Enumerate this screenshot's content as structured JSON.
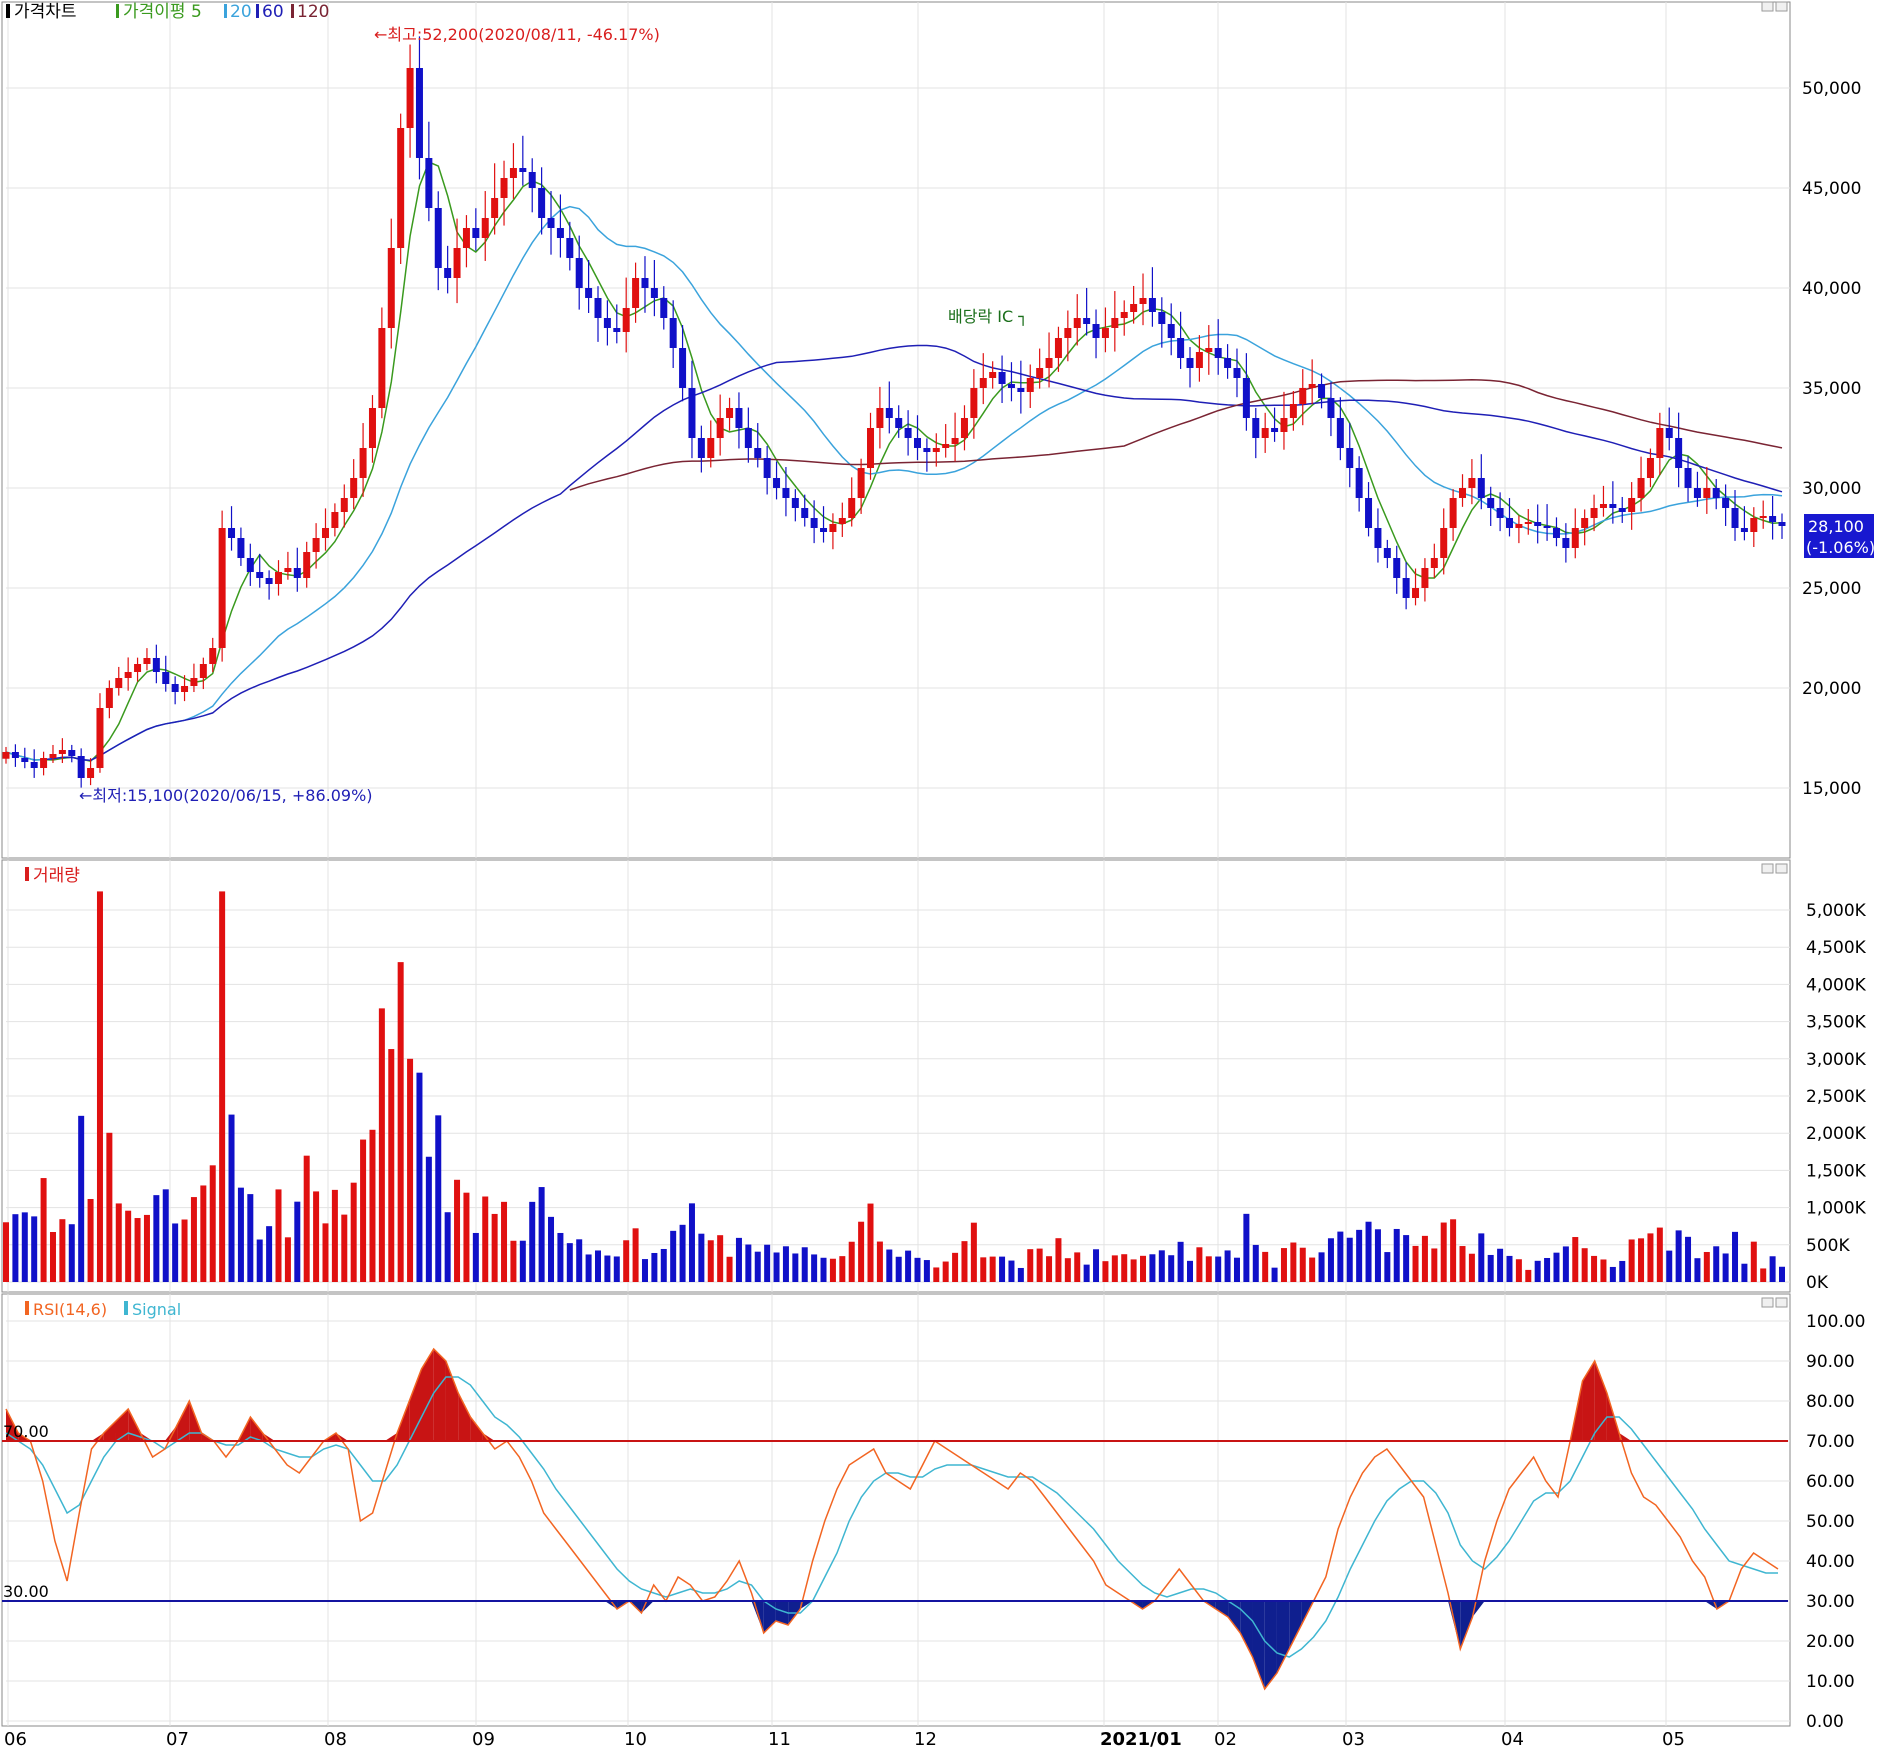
{
  "panels": {
    "price": {
      "legend": [
        {
          "label": "가격차트",
          "color": "#000000"
        },
        {
          "label": "가격이평 5",
          "color": "#3a9a1e"
        },
        {
          "label": "20",
          "color": "#3ba3dc"
        },
        {
          "label": "60",
          "color": "#1f1fb5"
        },
        {
          "label": "120",
          "color": "#7a2433"
        }
      ],
      "annotations": {
        "high": "←최고:52,200(2020/08/11, -46.17%)",
        "low": "←최저:15,100(2020/06/15, +86.09%)",
        "dividend": "배당락 ⅠC ┐"
      },
      "current_price": "28,100",
      "current_change": "(-1.06%)"
    },
    "volume": {
      "legend": "거래량"
    },
    "rsi": {
      "legend": [
        {
          "label": "RSI(14,6)",
          "color": "#f26522"
        },
        {
          "label": "Signal",
          "color": "#3fb6d1"
        }
      ],
      "level_high_label": "70.00",
      "level_low_label": "30.00"
    }
  },
  "chart_data": [
    {
      "type": "candlestick",
      "title": "가격차트",
      "x_labels": [
        "06",
        "07",
        "08",
        "09",
        "10",
        "11",
        "12",
        "2021/01",
        "02",
        "03",
        "04",
        "05"
      ],
      "ylim": [
        12000,
        54000
      ],
      "yticks": [
        "15,000",
        "20,000",
        "25,000",
        "30,000",
        "35,000",
        "40,000",
        "45,000",
        "50,000"
      ],
      "ytick_values": [
        15000,
        20000,
        25000,
        30000,
        35000,
        40000,
        45000,
        50000
      ],
      "series_close": [
        16800,
        16500,
        16300,
        16000,
        16500,
        16700,
        16900,
        16600,
        15500,
        16000,
        19000,
        20000,
        20500,
        20800,
        21200,
        21500,
        20800,
        20200,
        19800,
        20100,
        20500,
        21200,
        22000,
        28000,
        27500,
        26500,
        25800,
        25500,
        25200,
        25800,
        26000,
        25500,
        26800,
        27500,
        28000,
        28800,
        29500,
        30500,
        32000,
        34000,
        38000,
        42000,
        48000,
        51000,
        46500,
        44000,
        41000,
        40500,
        42000,
        43000,
        42500,
        43500,
        44500,
        45500,
        46000,
        45800,
        45000,
        43500,
        43000,
        42500,
        41500,
        40000,
        39500,
        38500,
        38000,
        37800,
        39000,
        40500,
        40000,
        39500,
        38500,
        37000,
        35000,
        32500,
        31500,
        32500,
        33500,
        34000,
        33000,
        32000,
        31500,
        30500,
        30000,
        29500,
        29000,
        28500,
        28000,
        27800,
        28200,
        28500,
        29500,
        31000,
        33000,
        34000,
        33500,
        33000,
        32500,
        32000,
        31800,
        32000,
        32200,
        32500,
        33500,
        35000,
        35500,
        35800,
        35200,
        35000,
        34800,
        35500,
        36000,
        36500,
        37500,
        38000,
        38500,
        38200,
        37500,
        38000,
        38500,
        38800,
        39200,
        39500,
        38800,
        38200,
        37500,
        36500,
        36000,
        36800,
        37000,
        36500,
        36000,
        35500,
        33500,
        32500,
        33000,
        32800,
        33500,
        34200,
        35000,
        35200,
        34500,
        33500,
        32000,
        31000,
        29500,
        28000,
        27000,
        26500,
        25500,
        24500,
        25000,
        26000,
        26500,
        28000,
        29500,
        30000,
        30500,
        29500,
        29000,
        28500,
        28000,
        28200,
        28300,
        28100,
        28000,
        27500,
        27000,
        28000,
        28500,
        29000,
        29200,
        29000,
        28800,
        29500,
        30500,
        31500,
        33000,
        32500,
        31000,
        30000,
        29500,
        30000,
        29500,
        29000,
        28000,
        27800,
        28500,
        28600,
        28300,
        28100
      ]
    },
    {
      "type": "bar",
      "title": "거래량",
      "ylim": [
        0,
        5300
      ],
      "yticks": [
        "0K",
        "500K",
        "1,000K",
        "1,500K",
        "2,000K",
        "2,500K",
        "3,000K",
        "3,500K",
        "4,000K",
        "4,500K",
        "5,000K"
      ],
      "ytick_values": [
        0,
        500,
        1000,
        1500,
        2000,
        2500,
        3000,
        3500,
        4000,
        4500,
        5000
      ],
      "spikes": [
        {
          "x": "07",
          "value": 5250
        },
        {
          "x": "08",
          "value": 3000
        }
      ]
    },
    {
      "type": "line",
      "title": "RSI(14,6)",
      "ylim": [
        0,
        100
      ],
      "yticks": [
        "0.00",
        "10.00",
        "20.00",
        "30.00",
        "40.00",
        "50.00",
        "60.00",
        "70.00",
        "80.00",
        "90.00",
        "100.00"
      ],
      "ytick_values": [
        0,
        10,
        20,
        30,
        40,
        50,
        60,
        70,
        80,
        90,
        100
      ],
      "levels": [
        70,
        30
      ],
      "series": [
        {
          "name": "RSI(14,6)",
          "values": [
            78,
            72,
            70,
            60,
            45,
            35,
            52,
            68,
            72,
            75,
            78,
            72,
            66,
            68,
            74,
            80,
            72,
            70,
            66,
            70,
            76,
            72,
            68,
            64,
            62,
            66,
            70,
            72,
            68,
            50,
            52,
            62,
            72,
            80,
            88,
            93,
            90,
            82,
            76,
            72,
            68,
            70,
            66,
            60,
            52,
            48,
            44,
            40,
            36,
            32,
            28,
            30,
            27,
            34,
            30,
            36,
            34,
            30,
            31,
            35,
            40,
            32,
            22,
            25,
            24,
            28,
            40,
            50,
            58,
            64,
            66,
            68,
            62,
            60,
            58,
            64,
            70,
            68,
            66,
            64,
            62,
            60,
            58,
            62,
            60,
            56,
            52,
            48,
            44,
            40,
            34,
            32,
            30,
            28,
            30,
            34,
            38,
            34,
            30,
            28,
            26,
            22,
            16,
            8,
            12,
            18,
            24,
            30,
            36,
            48,
            56,
            62,
            66,
            68,
            64,
            60,
            56,
            44,
            32,
            18,
            26,
            40,
            50,
            58,
            62,
            66,
            60,
            56,
            70,
            85,
            90,
            82,
            72,
            62,
            56,
            54,
            50,
            46,
            40,
            36,
            28,
            30,
            38,
            42,
            40,
            38
          ]
        },
        {
          "name": "Signal",
          "values": [
            72,
            70,
            68,
            64,
            58,
            52,
            54,
            60,
            66,
            70,
            72,
            71,
            70,
            68,
            70,
            72,
            72,
            70,
            69,
            69,
            71,
            70,
            68,
            67,
            66,
            66,
            68,
            69,
            68,
            64,
            60,
            60,
            64,
            70,
            76,
            82,
            86,
            86,
            84,
            80,
            76,
            74,
            71,
            67,
            63,
            58,
            54,
            50,
            46,
            42,
            38,
            35,
            33,
            32,
            31,
            32,
            33,
            32,
            32,
            33,
            35,
            34,
            30,
            28,
            27,
            27,
            30,
            36,
            42,
            50,
            56,
            60,
            62,
            62,
            61,
            61,
            63,
            64,
            64,
            64,
            63,
            62,
            61,
            61,
            61,
            59,
            57,
            54,
            51,
            48,
            44,
            40,
            37,
            34,
            32,
            31,
            32,
            33,
            33,
            32,
            30,
            28,
            25,
            20,
            17,
            16,
            18,
            21,
            25,
            31,
            38,
            44,
            50,
            55,
            58,
            60,
            60,
            57,
            52,
            44,
            40,
            38,
            41,
            45,
            50,
            55,
            57,
            57,
            60,
            66,
            72,
            76,
            76,
            73,
            69,
            65,
            61,
            57,
            53,
            48,
            44,
            40,
            39,
            38,
            37,
            37
          ]
        }
      ]
    }
  ]
}
